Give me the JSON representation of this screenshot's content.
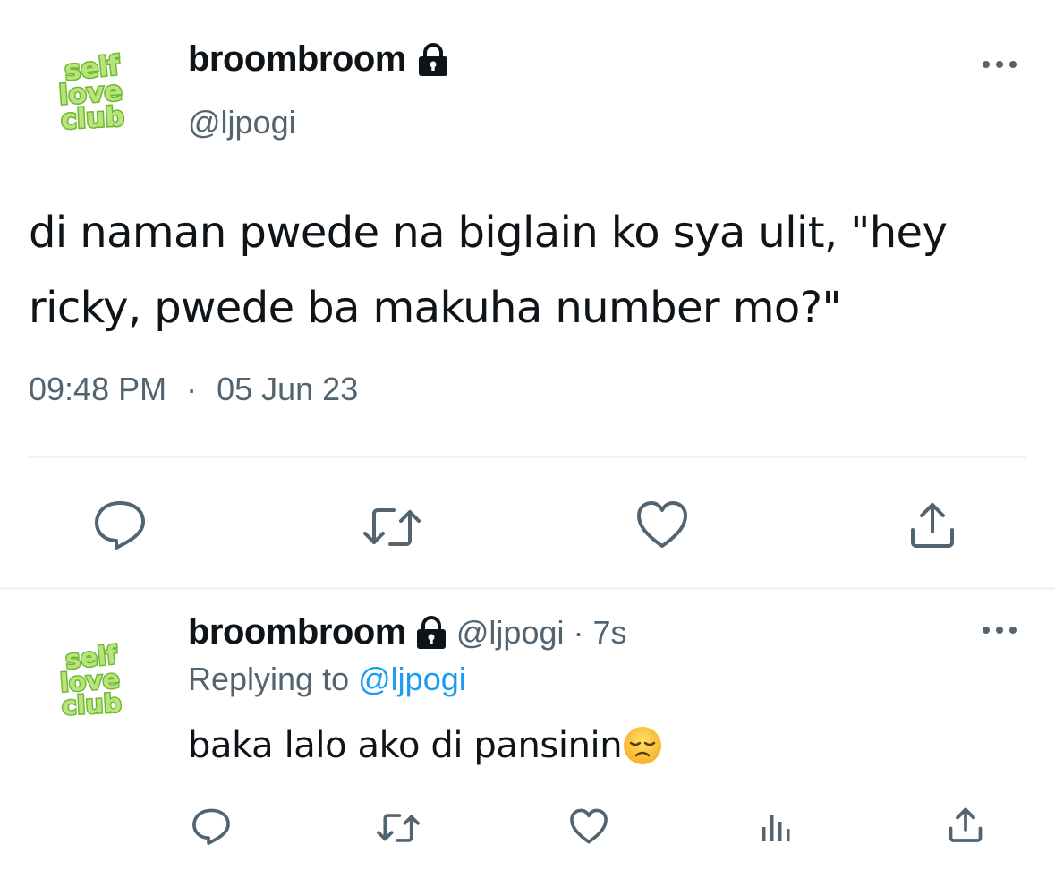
{
  "main_tweet": {
    "display_name": "broombroom",
    "handle": "@ljpogi",
    "avatar": {
      "text_lines": [
        "self",
        "love",
        "club"
      ],
      "color": "#8fd14f",
      "icon": "self-love-club-logo"
    },
    "text": "di naman pwede na biglain ko sya ulit, \"hey ricky, pwede ba makuha number mo?\"",
    "time": "09:48 PM",
    "separator": "·",
    "date": "05 Jun 23",
    "actions": [
      "reply-icon",
      "retweet-icon",
      "like-icon",
      "share-icon"
    ]
  },
  "reply_tweet": {
    "display_name": "broombroom",
    "handle": "@ljpogi",
    "separator": "·",
    "time_ago": "7s",
    "replying_prefix": "Replying to",
    "replying_to": "@ljpogi",
    "text": "baka lalo ako di pansinin",
    "emoji": "disappointed-face-emoji",
    "actions": [
      "reply-icon",
      "retweet-icon",
      "like-icon",
      "views-icon",
      "share-icon"
    ]
  },
  "colors": {
    "icon_gray": "#536471",
    "link_blue": "#1d9bf0",
    "text": "#0f1419",
    "divider": "#eff3f4",
    "avatar_green": "#8fd14f"
  }
}
